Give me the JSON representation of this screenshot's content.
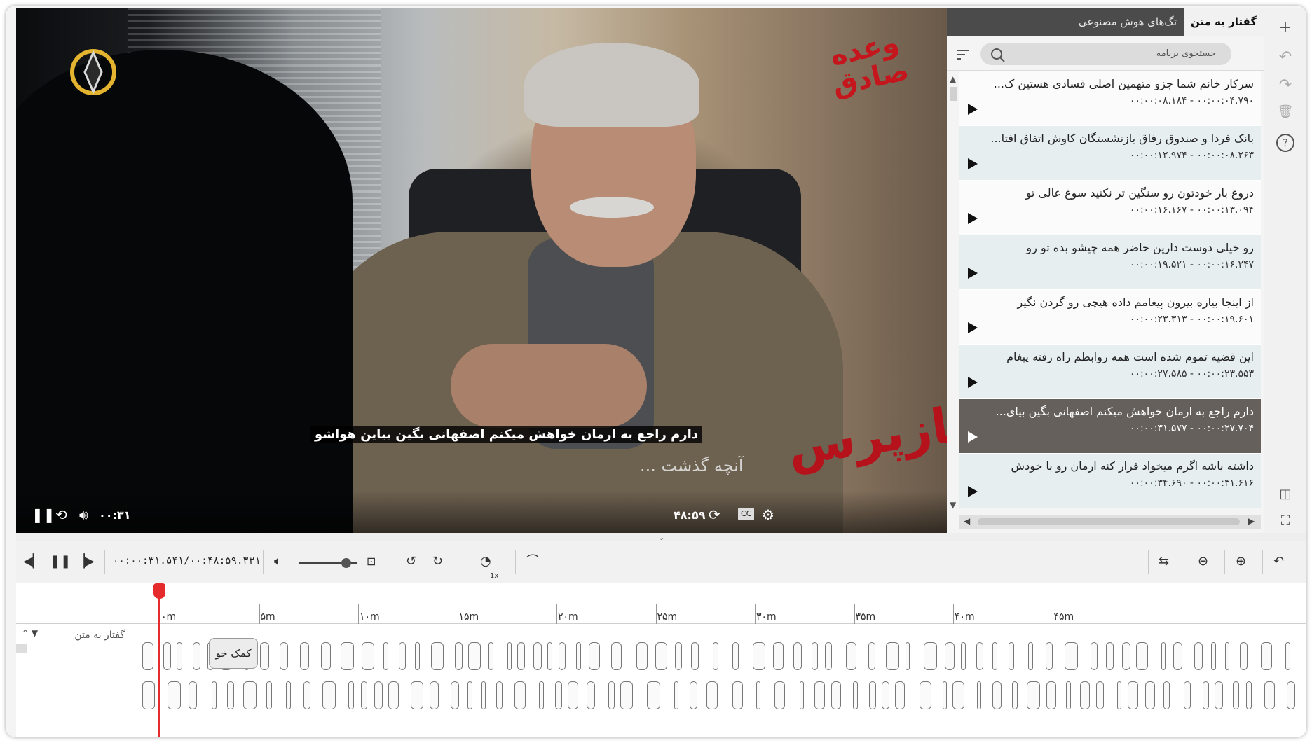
{
  "video": {
    "subtitle": "دارم راجع به ارمان خواهش میکنم اصفهانی بگین بیاین هواشو",
    "overlay_text": "آنچه گذشت ...",
    "brand_top": "وعده صادق",
    "brand_bottom": "بازپرس",
    "current_time": "۰۰:۳۱",
    "duration": "۴۸:۵۹",
    "cc_label": "CC"
  },
  "panel": {
    "tabs": [
      {
        "label": "گفتار به متن",
        "active": true
      },
      {
        "label": "تگ‌های هوش مصنوعی",
        "active": false
      }
    ],
    "search_placeholder": "جستجوی برنامه",
    "segments": [
      {
        "text": "سرکار خانم شما جزو متهمین اصلی فسادی هستین ک...",
        "time": "۰۰:۰۰:۰۴.۷۹۰   -   ۰۰:۰۰:۰۸.۱۸۴",
        "state": "odd"
      },
      {
        "text": "بانک فردا و صندوق رفاق بازنشستگان کاوش اتفاق افتا...",
        "time": "۰۰:۰۰:۰۸.۲۶۳   -   ۰۰:۰۰:۱۲.۹۷۴",
        "state": "even"
      },
      {
        "text": "دروغ بار خودتون رو سنگین تر نکنید سوغ عالی تو",
        "time": "۰۰:۰۰:۱۳.۰۹۴   -   ۰۰:۰۰:۱۶.۱۶۷",
        "state": "odd"
      },
      {
        "text": "رو خیلی دوست دارین حاضر همه چیشو بده تو رو",
        "time": "۰۰:۰۰:۱۶.۲۴۷   -   ۰۰:۰۰:۱۹.۵۲۱",
        "state": "even"
      },
      {
        "text": "از اینجا بیاره بیرون پیغامم داده هیچی رو گردن نگیر",
        "time": "۰۰:۰۰:۱۹.۶۰۱   -   ۰۰:۰۰:۲۳.۳۱۳",
        "state": "odd"
      },
      {
        "text": "این قضیه تموم شده است همه روابطم راه رفته پیغام",
        "time": "۰۰:۰۰:۲۳.۵۵۳   -   ۰۰:۰۰:۲۷.۵۸۵",
        "state": "even"
      },
      {
        "text": "دارم راجع به ارمان خواهش میکنم اصفهانی بگین بیای...",
        "time": "۰۰:۰۰:۲۷.۷۰۴   -   ۰۰:۰۰:۳۱.۵۷۷",
        "state": "sel"
      },
      {
        "text": "داشته باشه اگرم میخواد فرار کنه ارمان رو با خودش",
        "time": "۰۰:۰۰:۳۱.۶۱۶   -   ۰۰:۰۰:۳۴.۶۹۰",
        "state": "even"
      }
    ]
  },
  "transport": {
    "clock": "۰۰:۰۰:۳۱.۵۴۱/۰۰:۴۸:۵۹.۳۳۱",
    "speed": "1x",
    "volume": 0.82
  },
  "timeline": {
    "ticks": [
      "۰m",
      "۵m",
      "۱۰m",
      "۱۵m",
      "۲۰m",
      "۲۵m",
      "۳۰m",
      "۳۵m",
      "۴۰m",
      "۴۵m"
    ],
    "track_name": "گفتار به متن",
    "help_clip": "کمک خو"
  },
  "icons": {
    "add": "+",
    "undo": "↶",
    "redo": "↷",
    "delete": "🗑",
    "help": "?"
  }
}
